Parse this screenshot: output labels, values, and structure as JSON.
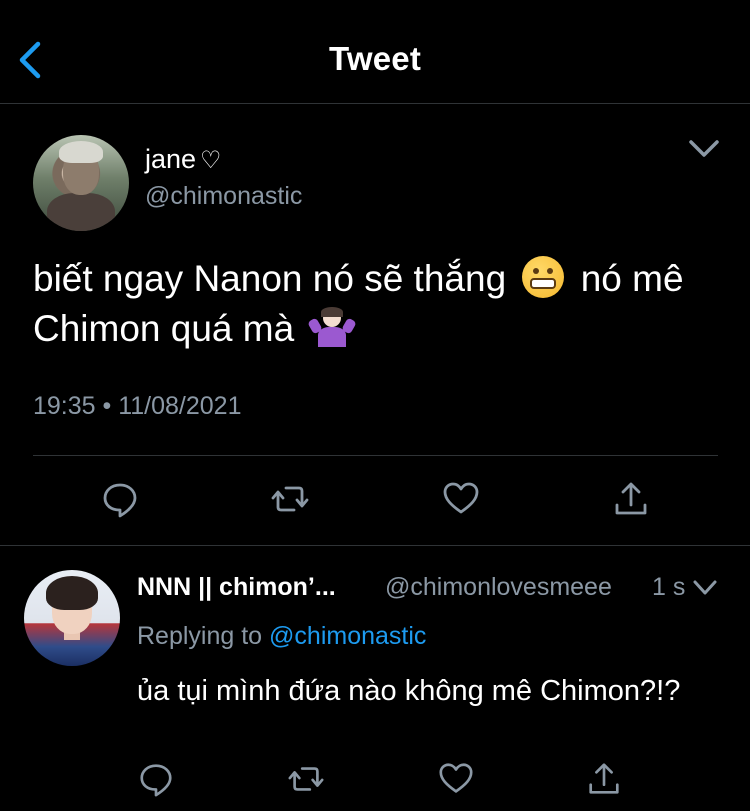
{
  "header": {
    "title": "Tweet",
    "back_icon": "chevron-left-icon",
    "accent_color": "#1d9bf0"
  },
  "tweet": {
    "name": "jane",
    "name_symbol": "♡",
    "handle": "@chimonastic",
    "text_part1": "biết ngay Nanon nó sẽ thắng",
    "text_part2": "nó mê Chimon quá mà",
    "emoji_1": "grimacing-face-icon",
    "emoji_2": "woman-shrugging-icon",
    "timestamp": "19:35 • 11/08/2021",
    "actions": [
      "reply-icon",
      "retweet-icon",
      "like-icon",
      "share-icon"
    ]
  },
  "reply": {
    "name": "NNN || chimon’...",
    "handle": "@chimonlovesmeee",
    "time": "1 s",
    "replying_prefix": "Replying to",
    "replying_to": "@chimonastic",
    "text": "ủa tụi mình đứa nào không mê Chimon?!?",
    "actions": [
      "reply-icon",
      "retweet-icon",
      "like-icon",
      "share-icon"
    ]
  },
  "colors": {
    "background": "#000000",
    "secondary_text": "#8b98a5",
    "divider": "#2f3336",
    "link": "#1d9bf0"
  }
}
